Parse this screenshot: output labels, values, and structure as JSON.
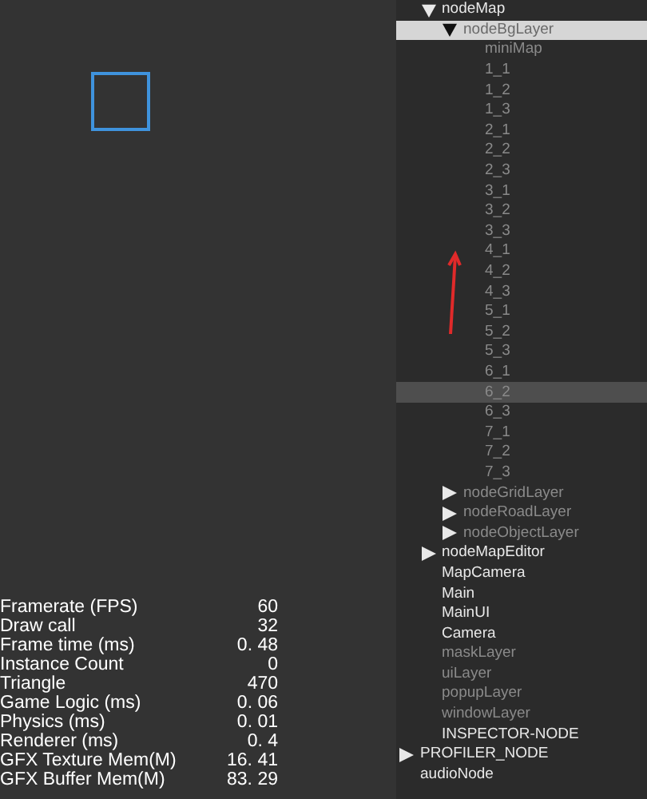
{
  "stats": [
    {
      "label": "Framerate (FPS)",
      "value": "60"
    },
    {
      "label": "Draw call",
      "value": "32"
    },
    {
      "label": "Frame time (ms)",
      "value": "0. 48"
    },
    {
      "label": "Instance Count",
      "value": "0"
    },
    {
      "label": "Triangle",
      "value": "470"
    },
    {
      "label": "Game Logic (ms)",
      "value": "0. 06"
    },
    {
      "label": "Physics (ms)",
      "value": "0. 01"
    },
    {
      "label": "Renderer (ms)",
      "value": "0. 4"
    },
    {
      "label": "GFX Texture Mem(M)",
      "value": "16. 41"
    },
    {
      "label": "GFX Buffer Mem(M)",
      "value": "83. 29"
    }
  ],
  "tree": {
    "items": [
      {
        "children": [
          {
            "label": "nodeMap",
            "expanded": true,
            "active": true,
            "selected": false,
            "hovered": false,
            "children": [
              {
                "label": "nodeBgLayer",
                "expanded": true,
                "active": false,
                "selected": true,
                "hovered": false,
                "children": [
                  {
                    "label": "miniMap",
                    "active": false,
                    "selected": false,
                    "hovered": false
                  },
                  {
                    "label": "1_1",
                    "active": false,
                    "selected": false,
                    "hovered": false
                  },
                  {
                    "label": "1_2",
                    "active": false,
                    "selected": false,
                    "hovered": false
                  },
                  {
                    "label": "1_3",
                    "active": false,
                    "selected": false,
                    "hovered": false
                  },
                  {
                    "label": "2_1",
                    "active": false,
                    "selected": false,
                    "hovered": false
                  },
                  {
                    "label": "2_2",
                    "active": false,
                    "selected": false,
                    "hovered": false
                  },
                  {
                    "label": "2_3",
                    "active": false,
                    "selected": false,
                    "hovered": false
                  },
                  {
                    "label": "3_1",
                    "active": false,
                    "selected": false,
                    "hovered": false
                  },
                  {
                    "label": "3_2",
                    "active": false,
                    "selected": false,
                    "hovered": false
                  },
                  {
                    "label": "3_3",
                    "active": false,
                    "selected": false,
                    "hovered": false
                  },
                  {
                    "label": "4_1",
                    "active": false,
                    "selected": false,
                    "hovered": false
                  },
                  {
                    "label": "4_2",
                    "active": false,
                    "selected": false,
                    "hovered": false
                  },
                  {
                    "label": "4_3",
                    "active": false,
                    "selected": false,
                    "hovered": false
                  },
                  {
                    "label": "5_1",
                    "active": false,
                    "selected": false,
                    "hovered": false
                  },
                  {
                    "label": "5_2",
                    "active": false,
                    "selected": false,
                    "hovered": false
                  },
                  {
                    "label": "5_3",
                    "active": false,
                    "selected": false,
                    "hovered": false
                  },
                  {
                    "label": "6_1",
                    "active": false,
                    "selected": false,
                    "hovered": false
                  },
                  {
                    "label": "6_2",
                    "active": false,
                    "selected": false,
                    "hovered": true
                  },
                  {
                    "label": "6_3",
                    "active": false,
                    "selected": false,
                    "hovered": false
                  },
                  {
                    "label": "7_1",
                    "active": false,
                    "selected": false,
                    "hovered": false
                  },
                  {
                    "label": "7_2",
                    "active": false,
                    "selected": false,
                    "hovered": false
                  },
                  {
                    "label": "7_3",
                    "active": false,
                    "selected": false,
                    "hovered": false
                  }
                ]
              },
              {
                "label": "nodeGridLayer",
                "expanded": false,
                "active": false,
                "selected": false,
                "hovered": false
              },
              {
                "label": "nodeRoadLayer",
                "expanded": false,
                "active": false,
                "selected": false,
                "hovered": false
              },
              {
                "label": "nodeObjectLayer",
                "expanded": false,
                "active": false,
                "selected": false,
                "hovered": false
              }
            ]
          },
          {
            "label": "nodeMapEditor",
            "expanded": false,
            "active": true,
            "selected": false,
            "hovered": false
          },
          {
            "label": "MapCamera",
            "active": true,
            "selected": false,
            "hovered": false
          },
          {
            "label": "Main",
            "active": true,
            "selected": false,
            "hovered": false
          },
          {
            "label": "MainUI",
            "active": true,
            "selected": false,
            "hovered": false
          },
          {
            "label": "Camera",
            "active": true,
            "selected": false,
            "hovered": false
          },
          {
            "label": "maskLayer",
            "active": false,
            "selected": false,
            "hovered": false
          },
          {
            "label": "uiLayer",
            "active": false,
            "selected": false,
            "hovered": false
          },
          {
            "label": "popupLayer",
            "active": false,
            "selected": false,
            "hovered": false
          },
          {
            "label": "windowLayer",
            "active": false,
            "selected": false,
            "hovered": false
          },
          {
            "label": "INSPECTOR-NODE",
            "active": true,
            "selected": false,
            "hovered": false
          }
        ]
      },
      {
        "label": "PROFILER_NODE",
        "expanded": false,
        "active": true,
        "selected": false,
        "hovered": false
      },
      {
        "label": "audioNode",
        "active": true,
        "selected": false,
        "hovered": false
      }
    ]
  }
}
